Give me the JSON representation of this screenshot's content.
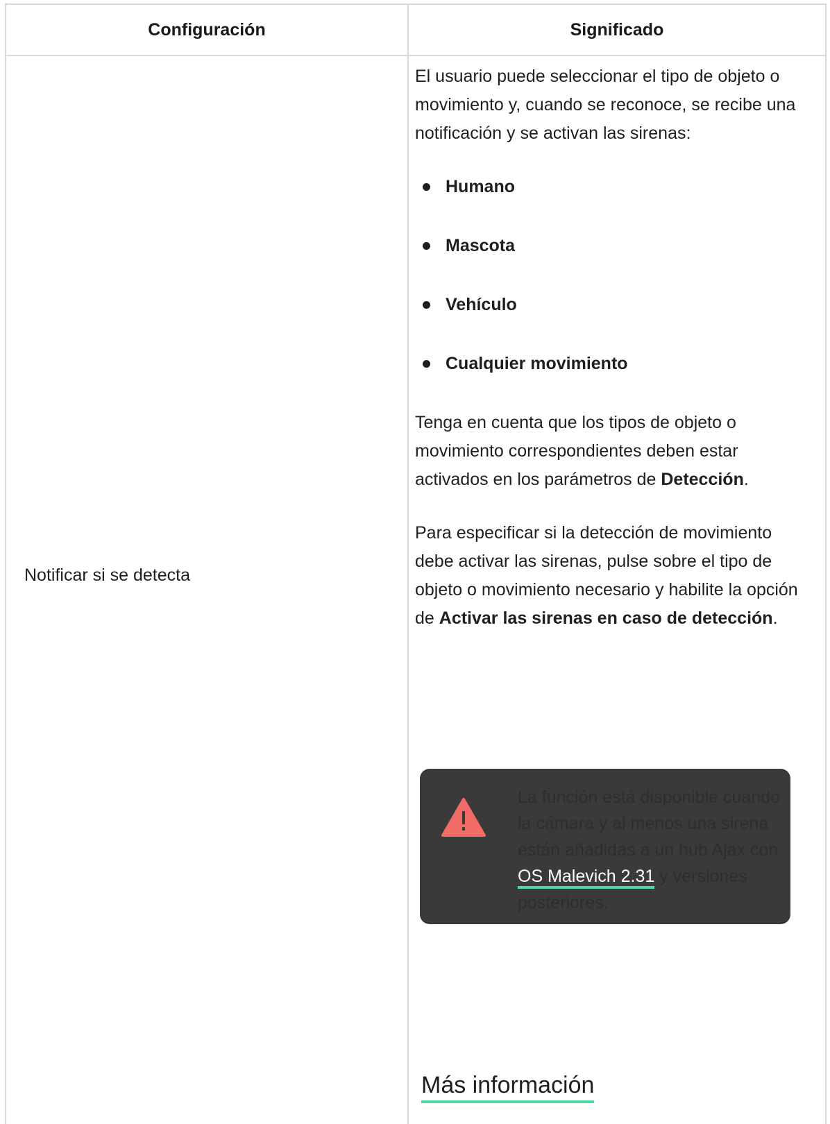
{
  "table": {
    "headers": {
      "setting": "Configuración",
      "meaning": "Significado"
    },
    "row": {
      "setting": "Notificar si se detecta",
      "intro": "El usuario puede seleccionar el tipo de objeto o movimiento y, cuando se reconoce, se recibe una notificación y se activan las sirenas:",
      "options": [
        "Humano",
        "Mascota",
        "Vehículo",
        "Cualquier movimiento"
      ],
      "note": {
        "text": "Tenga en cuenta que los tipos de objeto o movimiento correspondientes deben estar activados en los parámetros de ",
        "bold": "Detección",
        "end": "."
      },
      "instruction": {
        "text": "Para especificar si la detección de movimiento debe activar las sirenas, pulse sobre el tipo de objeto o movimiento necesario y habilite la opción de ",
        "bold": "Activar las sirenas en caso de detección",
        "end": "."
      },
      "warning": {
        "icon": "warning-icon",
        "text": "La función está disponible cuando la cámara y al menos una sirena están añadidas a un hub Ajax con ",
        "link": "OS Malevich 2.31",
        "end": " y versiones posteriores."
      },
      "more_info": "Más información"
    }
  },
  "colors": {
    "border": "#d9d9d9",
    "warning_bg": "#3a3a3a",
    "warning_icon": "#f26b66",
    "link_underline": "#4fd8a0"
  }
}
